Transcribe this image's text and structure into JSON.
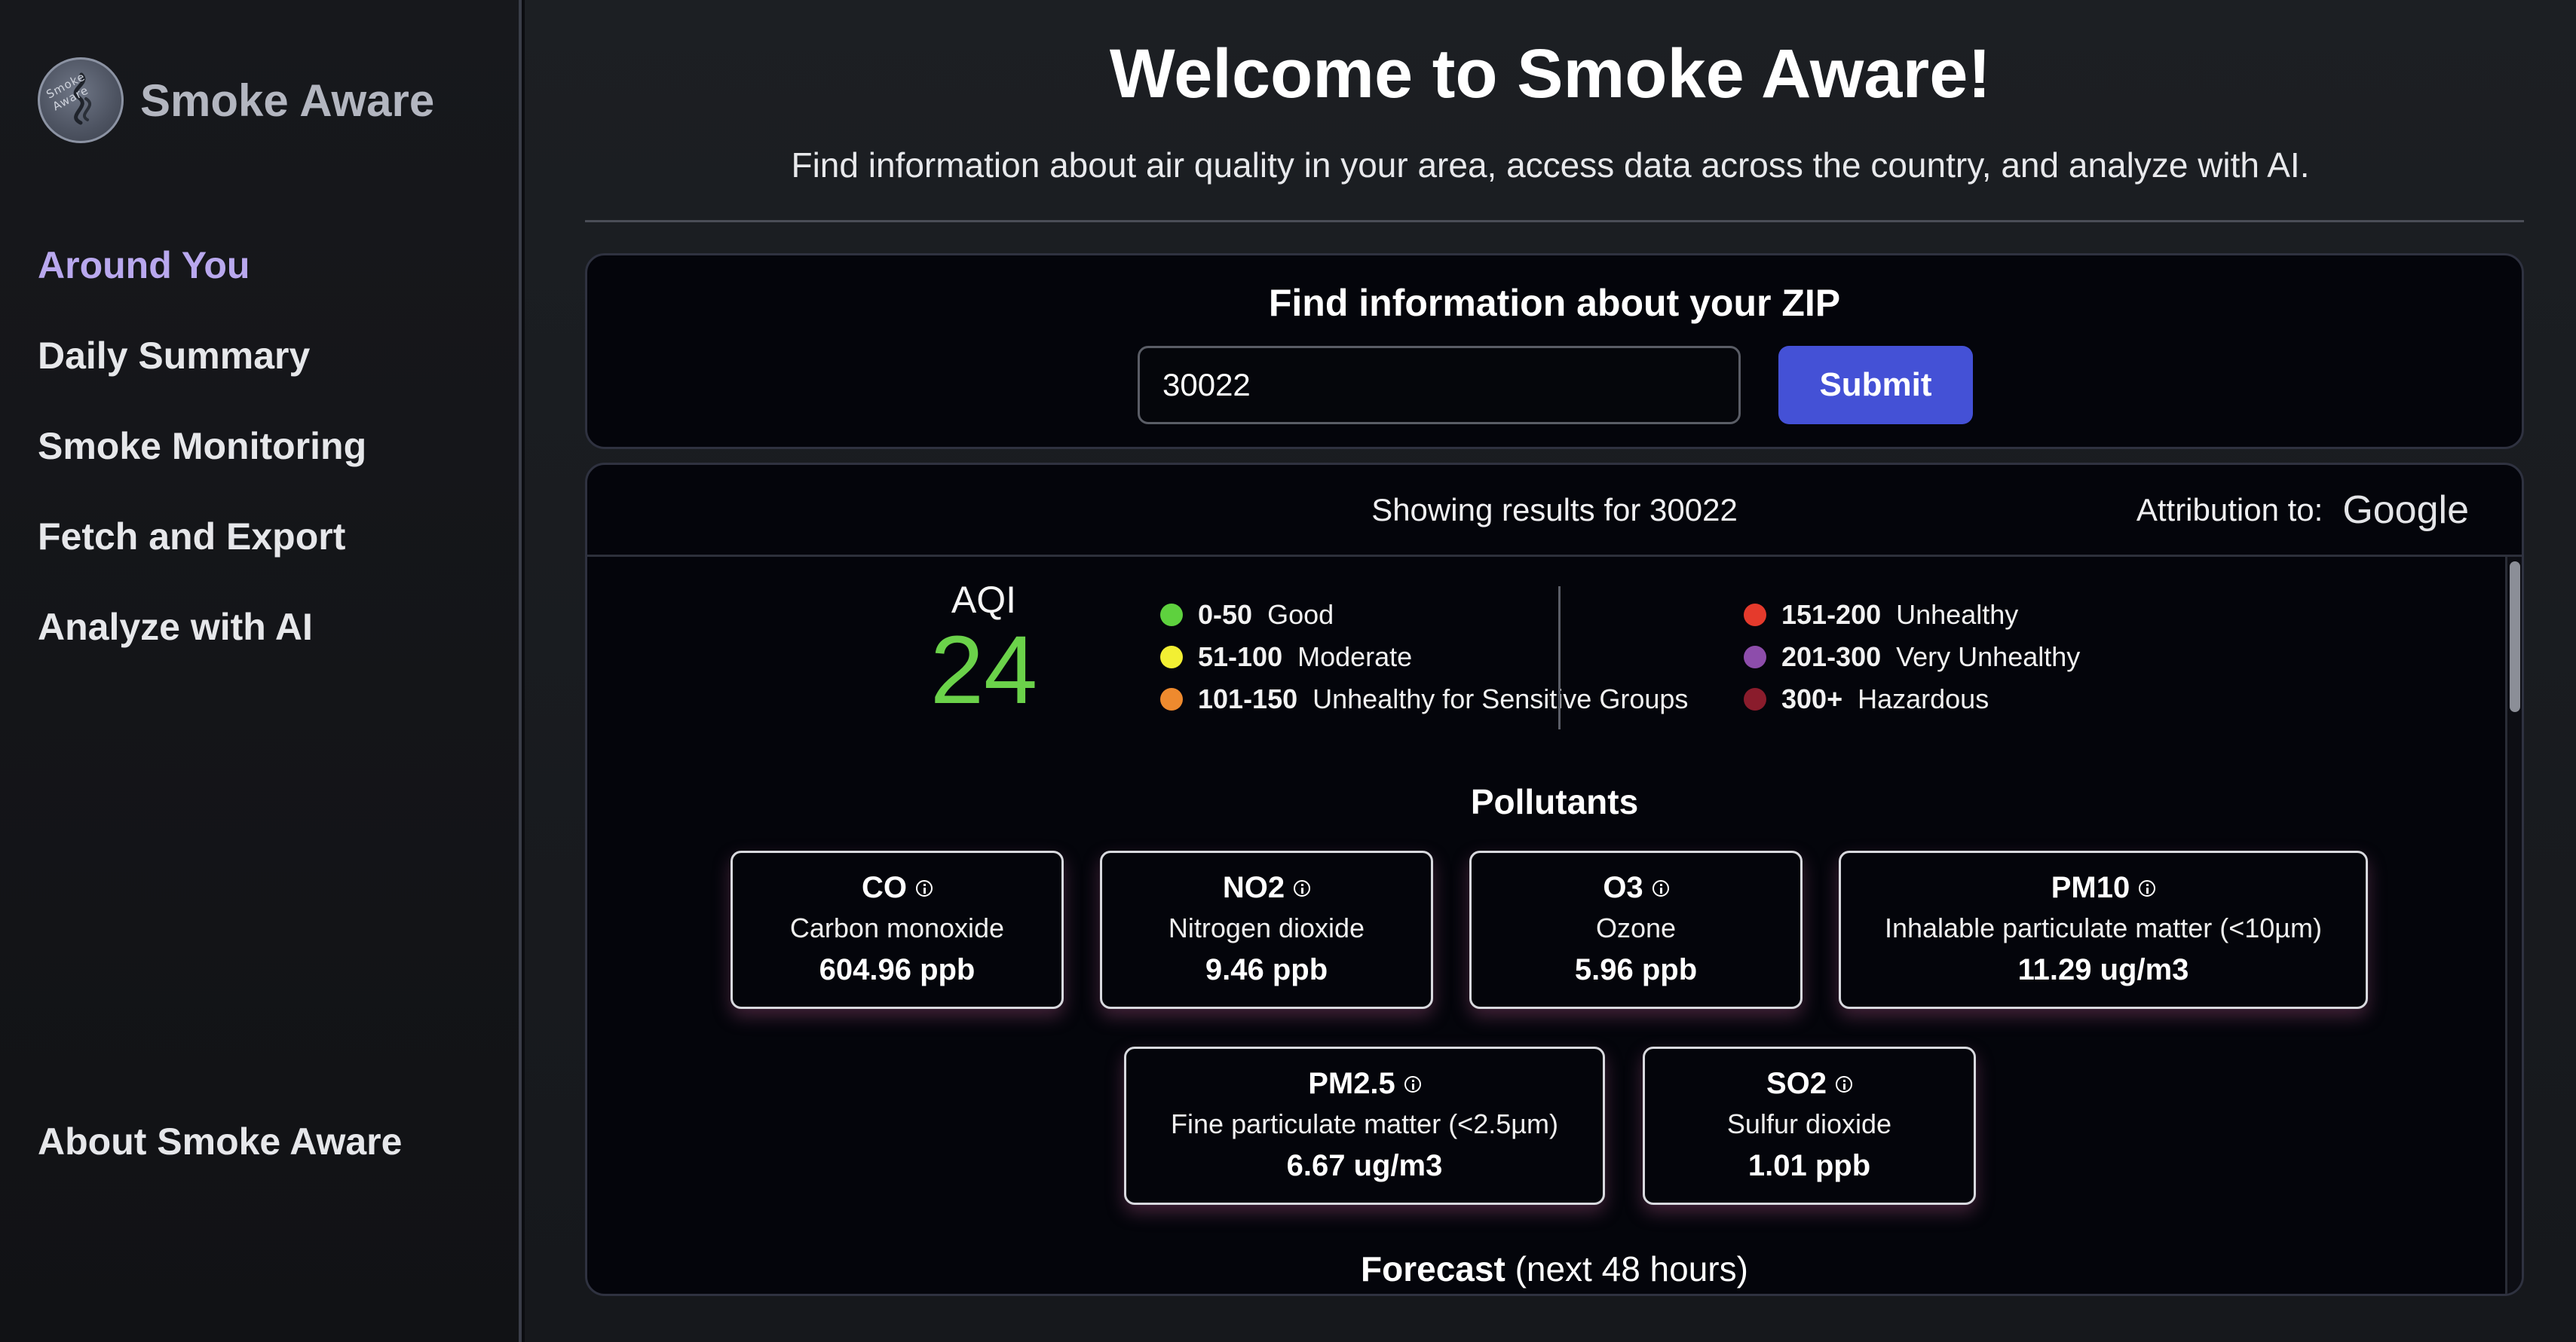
{
  "sidebar": {
    "brand_name": "Smoke Aware",
    "logo_text": "Smoke Aware",
    "items": [
      {
        "label": "Around You"
      },
      {
        "label": "Daily Summary"
      },
      {
        "label": "Smoke Monitoring"
      },
      {
        "label": "Fetch and Export"
      },
      {
        "label": "Analyze with AI"
      }
    ],
    "about_label": "About Smoke Aware",
    "active_color": "#b9a8ee"
  },
  "header": {
    "title": "Welcome to Smoke Aware!",
    "subtitle": "Find information about air quality in your area, access data across the country, and analyze with AI."
  },
  "zip_form": {
    "title": "Find information about your ZIP",
    "input_value": "30022",
    "submit_label": "Submit",
    "submit_color": "#4451d6"
  },
  "results": {
    "showing": "Showing results for 30022",
    "attribution_label": "Attribution to:",
    "attribution_brand": "Google",
    "aqi_label": "AQI",
    "aqi_value": "24",
    "aqi_color": "#6bd24a",
    "legend": [
      {
        "range": "0-50",
        "label": "Good",
        "color": "#5ed13e"
      },
      {
        "range": "51-100",
        "label": "Moderate",
        "color": "#f2ef33"
      },
      {
        "range": "101-150",
        "label": "Unhealthy for Sensitive Groups",
        "color": "#ee8a2e"
      },
      {
        "range": "151-200",
        "label": "Unhealthy",
        "color": "#e53a2c"
      },
      {
        "range": "201-300",
        "label": "Very Unhealthy",
        "color": "#8d4dab"
      },
      {
        "range": "300+",
        "label": "Hazardous",
        "color": "#8a1c2c"
      }
    ],
    "pollutants_title": "Pollutants",
    "pollutants": [
      {
        "code": "CO",
        "name": "Carbon monoxide",
        "value": "604.96 ppb"
      },
      {
        "code": "NO2",
        "name": "Nitrogen dioxide",
        "value": "9.46 ppb"
      },
      {
        "code": "O3",
        "name": "Ozone",
        "value": "5.96 ppb"
      },
      {
        "code": "PM10",
        "name": "Inhalable particulate matter (<10µm)",
        "value": "11.29 ug/m3"
      },
      {
        "code": "PM2.5",
        "name": "Fine particulate matter (<2.5µm)",
        "value": "6.67 ug/m3"
      },
      {
        "code": "SO2",
        "name": "Sulfur dioxide",
        "value": "1.01 ppb"
      }
    ],
    "forecast_title_bold": "Forecast",
    "forecast_title_rest": "(next 48 hours)"
  }
}
